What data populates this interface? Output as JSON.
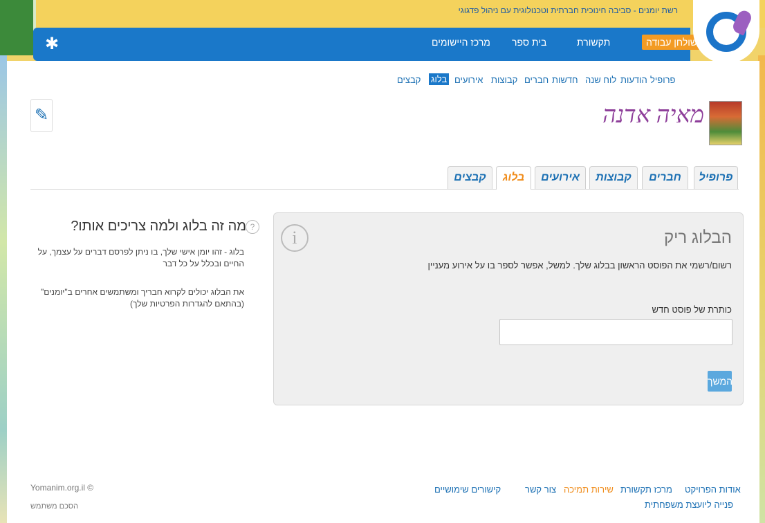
{
  "header": {
    "tagline": "רשת יומנים - סביבה חינוכית חברתית וטכנולוגית עם ניהול פדגוגי",
    "nav": [
      "שולחן עבודה",
      "תקשורת",
      "בית ספר",
      "מרכז היישומים"
    ],
    "active_nav": "שולחן עבודה"
  },
  "subnav": {
    "items": [
      "פרופיל",
      "הודעות",
      "לוח שנה",
      "חדשות",
      "חברים",
      "קבוצות",
      "אירועים",
      "בלוג",
      "קבצים"
    ],
    "active": "בלוג"
  },
  "profile": {
    "name": "מאיה אדנה"
  },
  "tabs": {
    "items": [
      "פרופיל",
      "חברים",
      "קבוצות",
      "אירועים",
      "בלוג",
      "קבצים"
    ],
    "active": "בלוג"
  },
  "blog_box": {
    "title": "הבלוג ריק",
    "description": "רשום/רשמי את הפוסט הראשון בבלוג שלך. למשל, אפשר לספר בו על אירוע מעניין",
    "post_title_label": "כותרת של פוסט חדש",
    "post_title_value": "",
    "continue_label": "המשך"
  },
  "help": {
    "title": "מה זה בלוג ולמה צריכים אותו?",
    "text1": "בלוג - זהו יומן אישי שלך, בו ניתן לפרסם דברים על עצמך, על החיים ובכלל על כל דבר",
    "text2": "את הבלוג יכולים לקרוא חבריך ומשתמשים אחרים ב\"יומנים\" (בהתאם להגדרות הפרטיות שלך)"
  },
  "footer": {
    "links": [
      "אודות הפרויקט",
      "מרכז תקשורת",
      "שירות תמיכה",
      "צור קשר",
      "קישורים שימושיים"
    ],
    "counsel": "פנייה ליועצת משפחתית",
    "copyright": "Yomanim.org.il ©",
    "terms": "הסכם משתמש"
  },
  "colors": {
    "nav_blue": "#1a78c9",
    "active_orange": "#f39b23",
    "link_blue": "#1a6fb3",
    "name_purple": "#8e3f9a",
    "button_blue": "#5ba8de"
  },
  "icons": [
    "gear-icon",
    "pencil-icon",
    "info-icon",
    "question-icon"
  ]
}
